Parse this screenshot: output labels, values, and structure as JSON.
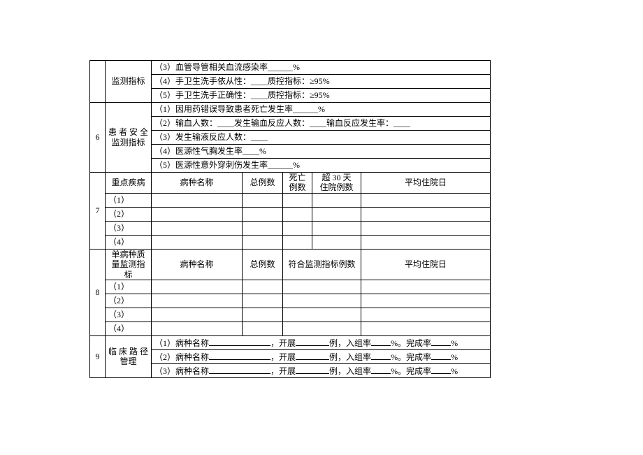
{
  "row_top_label": "监测指标",
  "row_top": [
    "（3）血管导管相关血流感染率______%",
    "（4）手卫生洗手依从性：____质控指标：≥95%",
    "（5）手卫生洗手正确性：____质控指标：≥95%"
  ],
  "sec6": {
    "idx": "6",
    "label": "患 者 安 全 监测指标",
    "rows": [
      "（1）因用药错误导致患者死亡发生率______%",
      "（2）输血人数：____发生输血反应人数：____输血反应发生率：____",
      "（3）发生输液反应人数：____",
      "（4）医源性气胸发生率____%",
      "（5）医源性意外穿刺伤发生率______%"
    ]
  },
  "sec7": {
    "idx": "7",
    "label": "重点疾病",
    "head": {
      "c1": "病种名称",
      "c2": "总例数",
      "c3": "死亡\n例数",
      "c4": "超 30 天\n住院例数",
      "c5": "平均住院日"
    },
    "rows": [
      "（1）",
      "（2）",
      "（3）",
      "（4）"
    ]
  },
  "sec8": {
    "idx": "8",
    "label": "单病种质量监测指标",
    "head": {
      "c1": "病种名称",
      "c2": "总例数",
      "c3": "符合监测指标例数",
      "c4": "平均住院日"
    },
    "rows": [
      "（1）",
      "（2）",
      "（3）",
      "（4）"
    ]
  },
  "sec9": {
    "idx": "9",
    "label": "临 床 路 径 管理",
    "rows": [
      {
        "no": "（1）",
        "a": "病种名称",
        "b": "，开展",
        "c": "例，入组率",
        "d": "%。完成率",
        "e": "%"
      },
      {
        "no": "（2）",
        "a": "病种名称",
        "b": "，开展",
        "c": "例，入组率",
        "d": "%。完成率",
        "e": "%"
      },
      {
        "no": "（3）",
        "a": "病种名称",
        "b": "，开展",
        "c": "例，入组率",
        "d": "%。完成率",
        "e": "%"
      }
    ]
  }
}
